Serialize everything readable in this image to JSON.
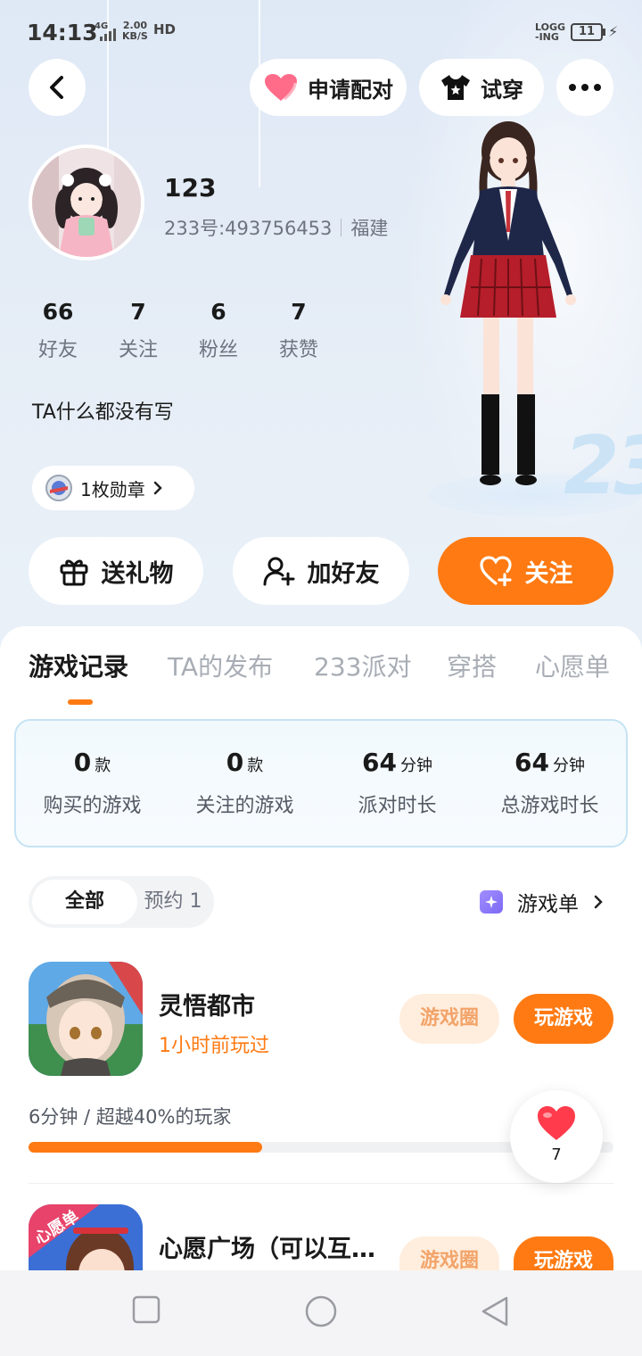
{
  "status_bar": {
    "time": "14:13",
    "network": "4G",
    "speed_value": "2.00",
    "speed_unit": "KB/S",
    "hd": "HD",
    "charging_line1": "LOGG",
    "charging_line2": "-ING",
    "battery": "11"
  },
  "header": {
    "match_label": "申请配对",
    "try_on_label": "试穿"
  },
  "profile": {
    "username": "123",
    "user_id": "233号:493756453",
    "location": "福建",
    "stats": [
      {
        "value": "66",
        "label": "好友"
      },
      {
        "value": "7",
        "label": "关注"
      },
      {
        "value": "6",
        "label": "粉丝"
      },
      {
        "value": "7",
        "label": "获赞"
      }
    ],
    "bio": "TA什么都没有写",
    "medal_label": "1枚勋章"
  },
  "actions": {
    "gift": "送礼物",
    "add_friend": "加好友",
    "follow": "关注"
  },
  "tabs": [
    "游戏记录",
    "TA的发布",
    "233派对",
    "穿搭",
    "心愿单"
  ],
  "summary": [
    {
      "value": "0",
      "unit": "款",
      "label": "购买的游戏"
    },
    {
      "value": "0",
      "unit": "款",
      "label": "关注的游戏"
    },
    {
      "value": "64",
      "unit": "分钟",
      "label": "派对时长"
    },
    {
      "value": "64",
      "unit": "分钟",
      "label": "总游戏时长"
    }
  ],
  "filter": {
    "all": "全部",
    "reserve": "预约 1"
  },
  "game_list_link": "游戏单",
  "games": [
    {
      "title": "灵悟都市",
      "last_played": "1小时前玩过",
      "circle_label": "游戏圈",
      "play_label": "玩游戏",
      "playtime": "6分钟 / 超越40%的玩家",
      "progress": 0.4
    },
    {
      "title": "心愿广场（可以互…",
      "badge": "心愿单",
      "circle_label": "游戏圈",
      "play_label": "玩游戏"
    }
  ],
  "likes": {
    "count": "7"
  },
  "colors": {
    "accent": "#ff7a12",
    "background_top": "#dfe9f6"
  }
}
